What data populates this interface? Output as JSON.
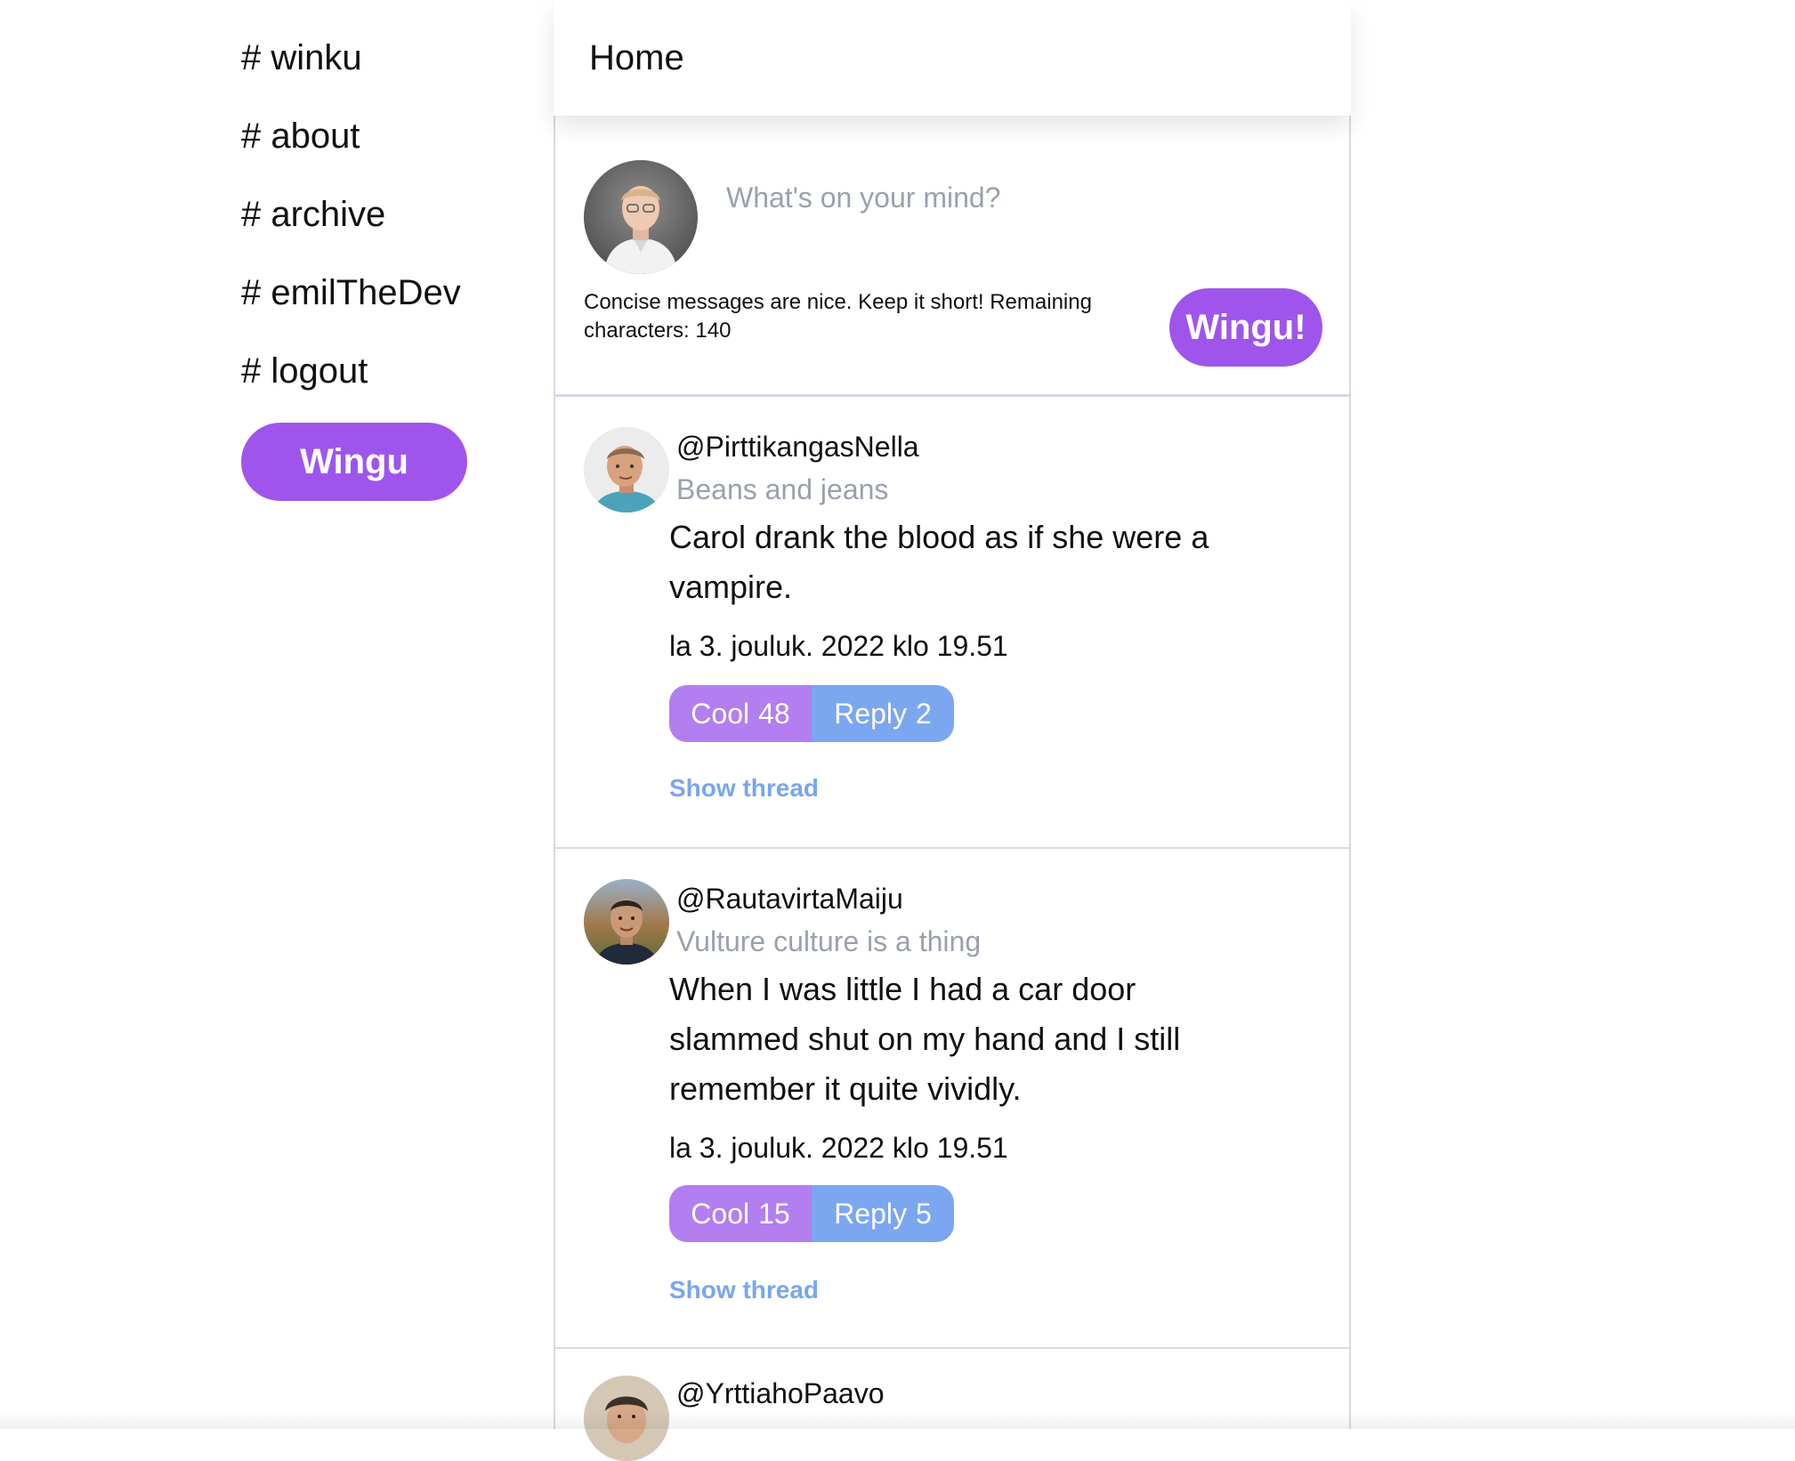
{
  "sidebar": {
    "items": [
      {
        "label": "# winku"
      },
      {
        "label": "# about"
      },
      {
        "label": "# archive"
      },
      {
        "label": "# emilTheDev"
      },
      {
        "label": "# logout"
      }
    ],
    "button_label": "Wingu"
  },
  "header": {
    "title": "Home"
  },
  "composer": {
    "placeholder": "What's on your mind?",
    "hint": "Concise messages are nice. Keep it short! Remaining characters: 140",
    "submit_label": "Wingu!"
  },
  "posts": [
    {
      "handle": "@PirttikangasNella",
      "bio": "Beans and jeans",
      "text": "Carol drank the blood as if she were a vampire.",
      "date": "la 3. jouluk. 2022 klo 19.51",
      "cool_label": "Cool",
      "cool_count": "48",
      "reply_label": "Reply",
      "reply_count": "2",
      "thread_label": "Show thread"
    },
    {
      "handle": "@RautavirtaMaiju",
      "bio": "Vulture culture is a thing",
      "text": "When I was little I had a car door slammed shut on my hand and I still remember it quite vividly.",
      "date": "la 3. jouluk. 2022 klo 19.51",
      "cool_label": "Cool",
      "cool_count": "15",
      "reply_label": "Reply",
      "reply_count": "5",
      "thread_label": "Show thread"
    },
    {
      "handle": "@YrttiahoPaavo"
    }
  ]
}
